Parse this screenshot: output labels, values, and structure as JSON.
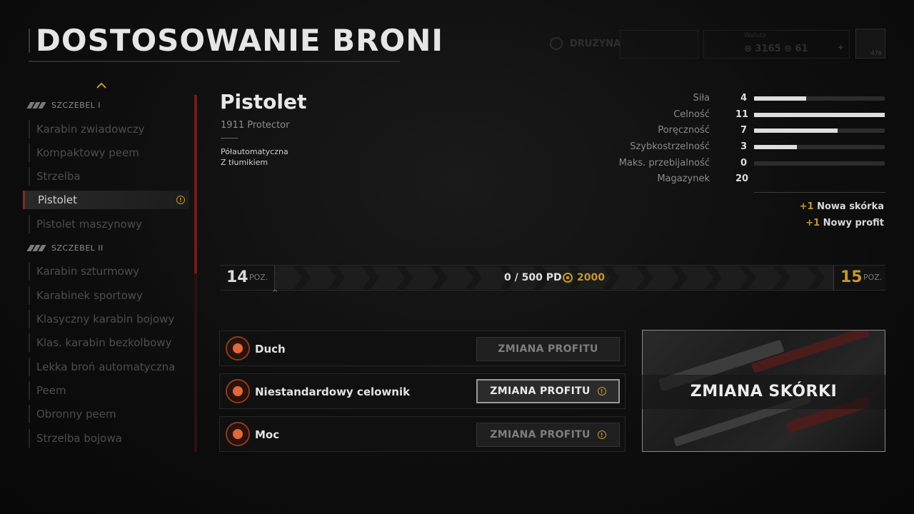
{
  "header": {
    "title": "DOSTOSOWANIE BRONI",
    "team_label": "DRUŻYNA",
    "currency_label": "Waluta",
    "currency_a": "3165",
    "currency_b": "61",
    "avatar_level": "476"
  },
  "sidebar": {
    "tiers": [
      {
        "label": "SZCZEBEL I"
      },
      {
        "label": "SZCZEBEL II"
      }
    ],
    "items": [
      {
        "label": "Karabin zwiadowczy"
      },
      {
        "label": "Kompaktowy peem"
      },
      {
        "label": "Strzelba"
      },
      {
        "label": "Pistolet"
      },
      {
        "label": "Pistolet maszynowy"
      },
      {
        "label": "Karabin szturmowy"
      },
      {
        "label": "Karabinek sportowy"
      },
      {
        "label": "Klasyczny karabin bojowy"
      },
      {
        "label": "Klas. karabin bezkolbowy"
      },
      {
        "label": "Lekka broń automatyczna"
      },
      {
        "label": "Peem"
      },
      {
        "label": "Obronny peem"
      },
      {
        "label": "Strzelba bojowa"
      }
    ],
    "active_index": 3,
    "warn_symbol": "!"
  },
  "weapon": {
    "class": "Pistolet",
    "name": "1911 Protector",
    "traits": [
      "Półautomatyczna",
      "Z tłumikiem"
    ]
  },
  "stats": [
    {
      "label": "Siła",
      "value": "4",
      "level": 0.4
    },
    {
      "label": "Celność",
      "value": "11",
      "level": 1.0
    },
    {
      "label": "Poręczność",
      "value": "7",
      "level": 0.64
    },
    {
      "label": "Szybkostrzelność",
      "value": "3",
      "level": 0.33
    },
    {
      "label": "Maks. przebijalność",
      "value": "0",
      "level": 0
    },
    {
      "label": "Magazynek",
      "value": "20",
      "level": null
    }
  ],
  "rewards": [
    {
      "plus": "+1",
      "label": "Nowa skórka"
    },
    {
      "plus": "+1",
      "label": "Nowy profit"
    }
  ],
  "level": {
    "current": "14",
    "next": "15",
    "suffix": "POZ.",
    "xp_text": "0 / 500 PD",
    "xp_reward": "2000",
    "progress": 0
  },
  "perks": [
    {
      "name": "Duch",
      "button": "ZMIANA PROFITU",
      "focused": false,
      "warn": false
    },
    {
      "name": "Niestandardowy celownik",
      "button": "ZMIANA PROFITU",
      "focused": true,
      "warn": true
    },
    {
      "name": "Moc",
      "button": "ZMIANA PROFITU",
      "focused": false,
      "warn": true
    }
  ],
  "skin": {
    "label": "ZMIANA SKÓRKI"
  },
  "colors": {
    "accent_gold": "#c8962e",
    "accent_red": "#7b2a2a",
    "perk_orange": "#e0683c"
  }
}
